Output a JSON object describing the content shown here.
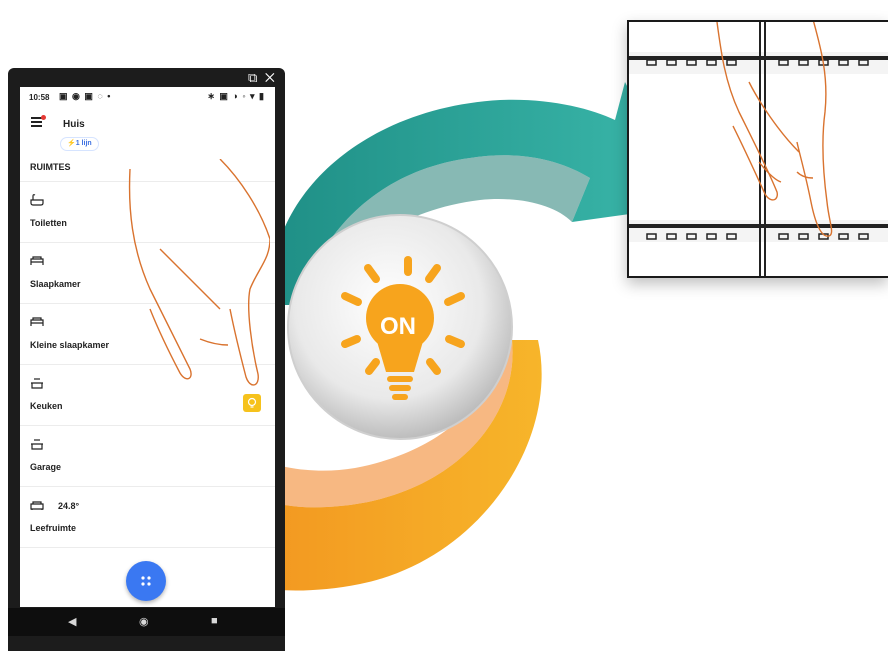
{
  "status_bar": {
    "time": "10:58",
    "left_icons": "▣ ◉ ▣ ◌ •",
    "right_icons": "∗ ▣ ◑ ◦ ▾ ▮"
  },
  "window_controls": {
    "popout": "⧉",
    "close": "✕"
  },
  "header": {
    "home_name": "Huis",
    "lines_badge": "⚡1 lijn"
  },
  "rooms_title": "RUIMTES",
  "rooms": [
    {
      "label": "Toiletten",
      "icon": "bathtub-icon",
      "temperature": ""
    },
    {
      "label": "Slaapkamer",
      "icon": "bed-icon",
      "temperature": ""
    },
    {
      "label": "Kleine slaapkamer",
      "icon": "bed-icon",
      "temperature": ""
    },
    {
      "label": "Keuken",
      "icon": "cooking-pot-icon",
      "temperature": ""
    },
    {
      "label": "Garage",
      "icon": "cooking-pot-icon",
      "temperature": ""
    },
    {
      "label": "Leefruimte",
      "icon": "sofa-icon",
      "temperature": "24.8°"
    }
  ],
  "bulb_badge_icon": "lightbulb-icon",
  "fab_icon": "grid-dots-icon",
  "nav": {
    "back": "◀",
    "home": "◉",
    "recents": "■"
  },
  "center_badge": {
    "text": "ON",
    "icon": "lightbulb-icon"
  },
  "colors": {
    "teal_arrow": "#2fa89c",
    "orange_arrow": "#f29a1e",
    "bulb": "#f7a41d",
    "fab": "#3a78f2",
    "badge": "#f6c21c",
    "hand_outline": "#d9732f"
  }
}
